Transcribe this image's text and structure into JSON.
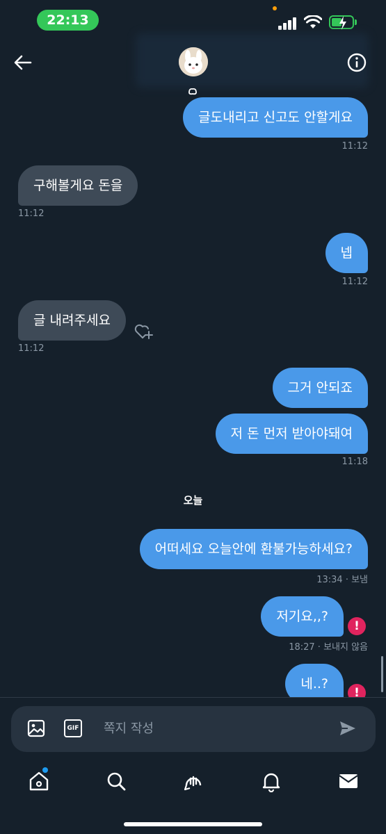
{
  "status_bar": {
    "time": "22:13"
  },
  "header": {},
  "messages": [
    {
      "id": "m1",
      "text": "글도내리고 신고도 안할게요",
      "dir": "out",
      "time": "11:12"
    },
    {
      "id": "m2",
      "text": "구해볼게요 돈을",
      "dir": "in",
      "time": "11:12"
    },
    {
      "id": "m3",
      "text": "넵",
      "dir": "out",
      "time": "11:12"
    },
    {
      "id": "m4",
      "text": "글 내려주세요",
      "dir": "in",
      "time": "11:12"
    },
    {
      "id": "m5",
      "text": "그거 안되죠",
      "dir": "out"
    },
    {
      "id": "m6",
      "text": "저 돈 먼저 받아야돼여",
      "dir": "out",
      "time": "11:18"
    },
    {
      "id": "m7",
      "text": "어떠세요 오늘안에 환불가능하세요?",
      "dir": "out",
      "time": "13:34 · 보냄"
    },
    {
      "id": "m8",
      "text": "저기요,,?",
      "dir": "out",
      "time": "18:27 · 보내지 않음",
      "error": "!"
    },
    {
      "id": "m9",
      "text": "네..?",
      "dir": "out",
      "error": "!"
    }
  ],
  "day_separator": "오늘",
  "composer": {
    "placeholder": "쪽지 작성",
    "gif_label": "GIF"
  },
  "nav": {
    "items": [
      {
        "name": "home",
        "icon": "home-icon",
        "has_notification_dot": true
      },
      {
        "name": "search",
        "icon": "search-icon"
      },
      {
        "name": "spaces",
        "icon": "spaces-icon"
      },
      {
        "name": "notifications",
        "icon": "bell-icon"
      },
      {
        "name": "messages",
        "icon": "envelope-icon",
        "active": true
      }
    ]
  },
  "colors": {
    "background": "#15202b",
    "outgoing_bubble": "#4a99e9",
    "incoming_bubble": "#3e4a57",
    "error": "#e0245e",
    "status_pill": "#34c759"
  }
}
